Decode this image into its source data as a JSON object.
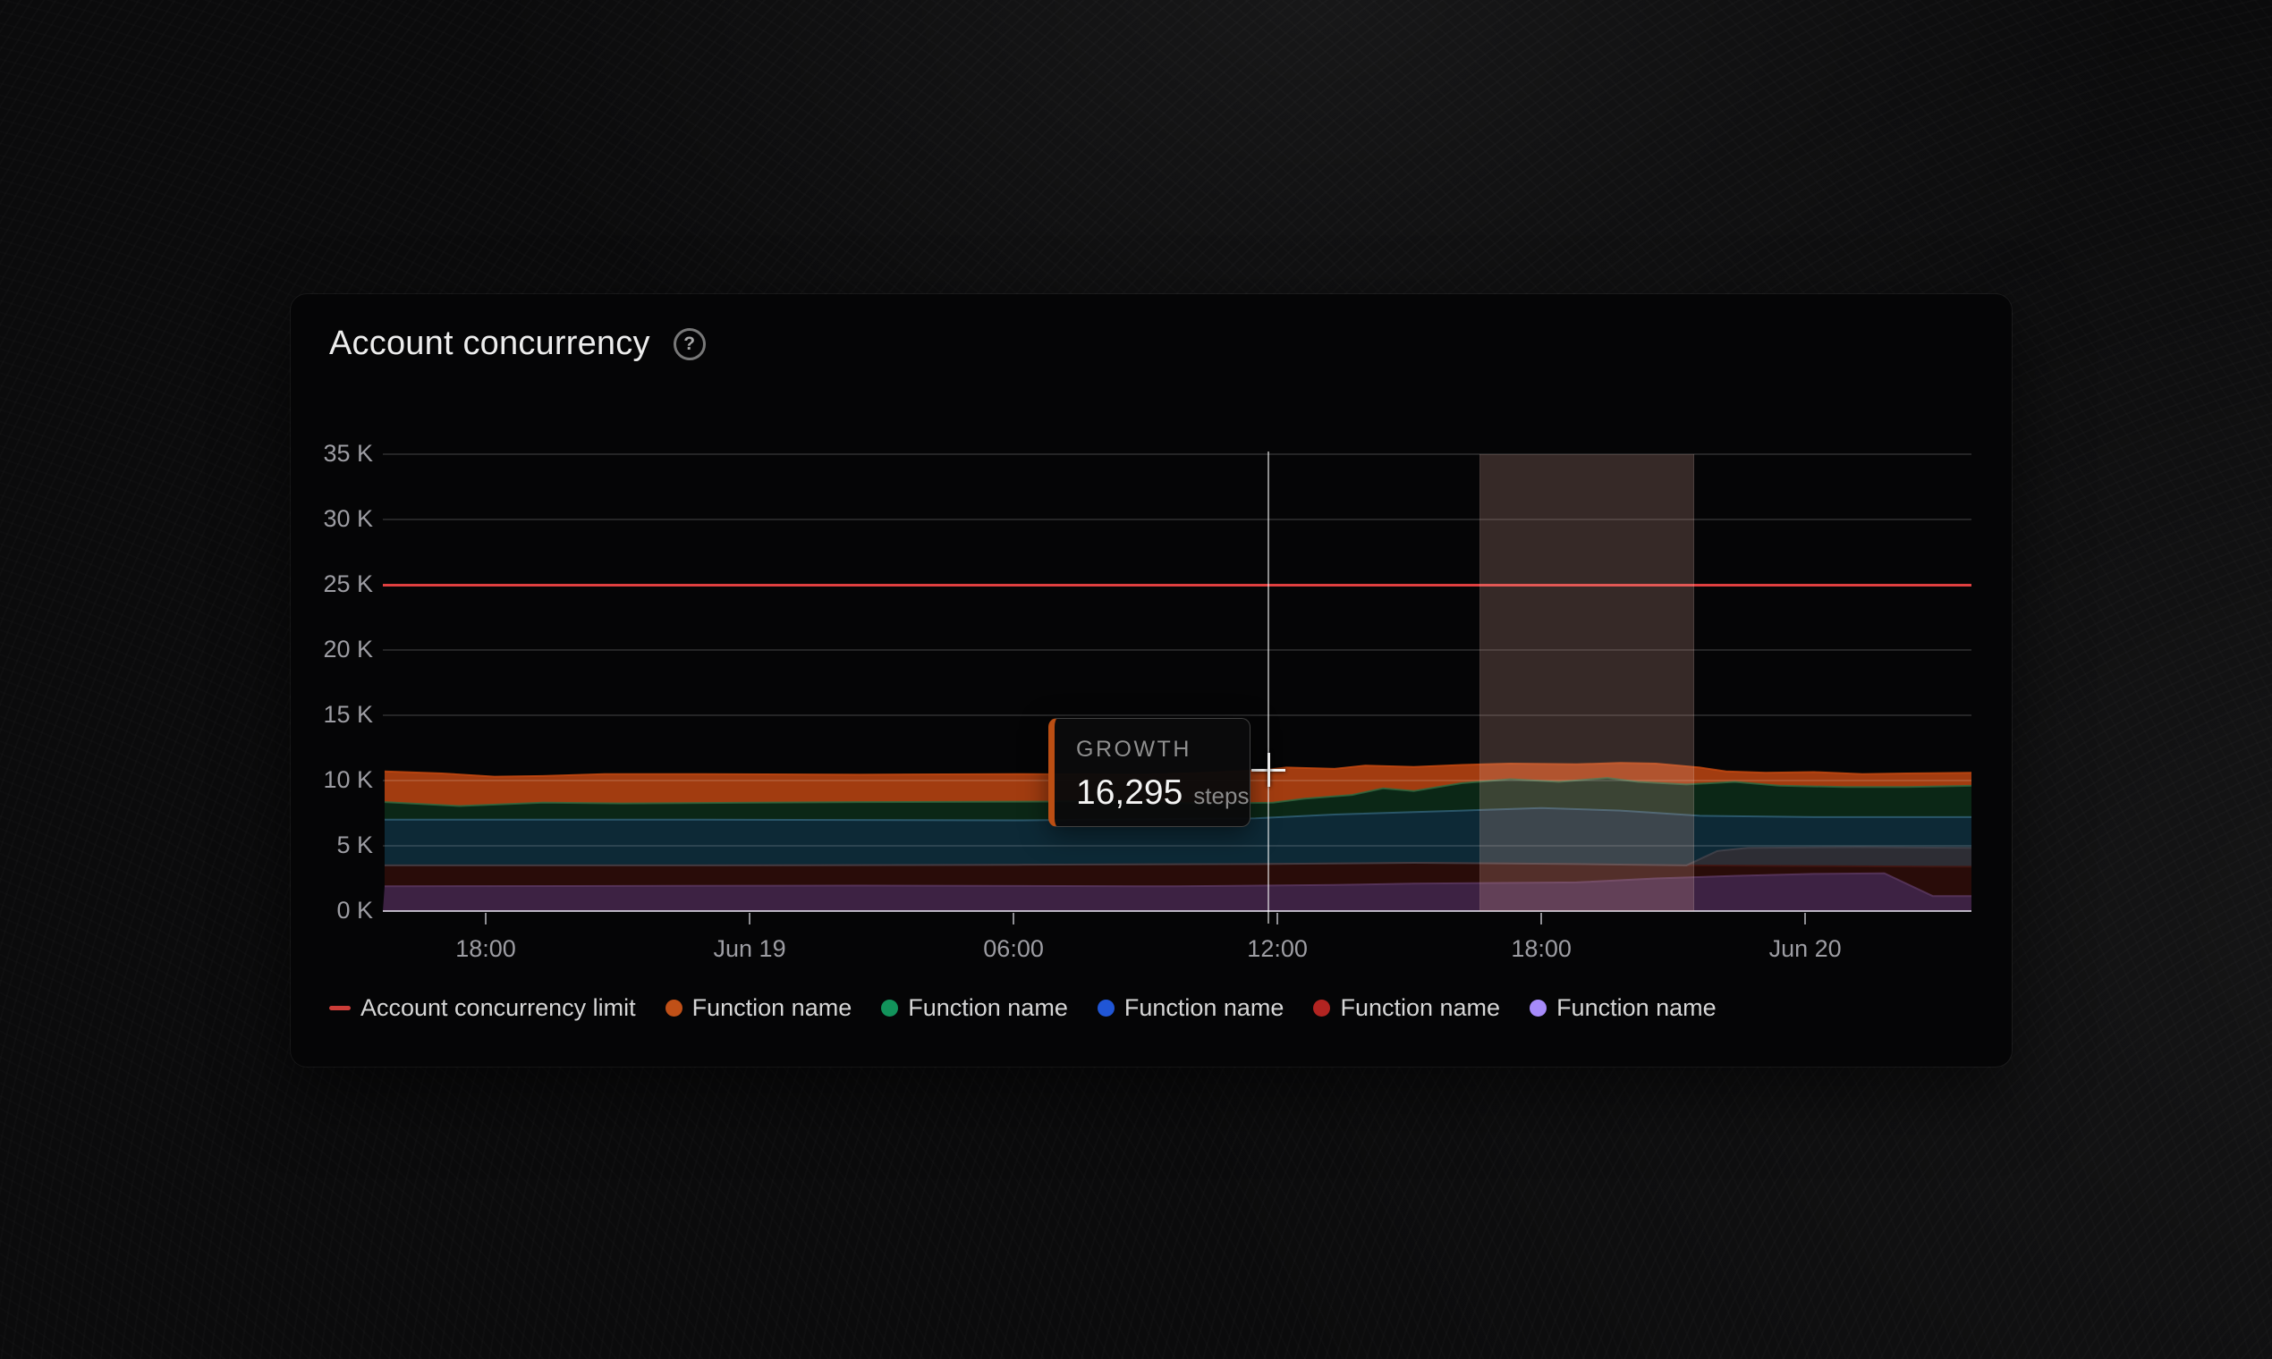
{
  "card": {
    "title": "Account concurrency",
    "help_icon_glyph": "?"
  },
  "chart_data": {
    "type": "area",
    "variant": "stacked",
    "title": "Account concurrency",
    "grid": "horizontal",
    "legend_position": "bottom",
    "y_axis": {
      "unit": "K",
      "ticks_k": [
        35,
        30,
        25,
        20,
        15,
        10,
        5,
        0
      ],
      "tick_labels": [
        "35 K",
        "30 K",
        "25 K",
        "20 K",
        "15 K",
        "10 K",
        "5 K",
        "0 K"
      ],
      "ylim_k": [
        0,
        35
      ]
    },
    "x_axis": {
      "domain_h": [
        -2.34,
        33.78
      ],
      "hours_per_major_tick": 6,
      "ticks": [
        {
          "h": 0,
          "label": "18:00"
        },
        {
          "h": 6,
          "label": "Jun 19"
        },
        {
          "h": 12,
          "label": "06:00"
        },
        {
          "h": 18,
          "label": "12:00"
        },
        {
          "h": 24,
          "label": "18:00"
        },
        {
          "h": 30,
          "label": "Jun 20"
        }
      ]
    },
    "limit_line": {
      "label": "Account concurrency limit",
      "value_k": 25,
      "color": "#e04040"
    },
    "highlight_window": {
      "from_h": 22.6,
      "to_h": 27.45
    },
    "crosshair": {
      "h": 17.8,
      "value_k": 10.8
    },
    "tooltip": {
      "series": "GROWTH",
      "value": "16,295",
      "unit": "steps"
    },
    "bands_note": "stacked band top boundaries; x = hours from first tick (18:00), y = thousands (K)",
    "bands": [
      {
        "name": "function-purple",
        "label": "Function name",
        "color": "#3d2243",
        "stroke": "#5c3a63",
        "points": [
          [
            -2.3,
            1.9
          ],
          [
            8.5,
            1.95
          ],
          [
            15.7,
            1.9
          ],
          [
            19.3,
            2.0
          ],
          [
            21.1,
            2.1
          ],
          [
            24.8,
            2.2
          ],
          [
            26.6,
            2.5
          ],
          [
            28.4,
            2.7
          ],
          [
            30.2,
            2.85
          ],
          [
            31.8,
            2.9
          ],
          [
            32.9,
            1.15
          ],
          [
            33.8,
            1.15
          ]
        ]
      },
      {
        "name": "function-red",
        "label": "Function name",
        "color": "#290c09",
        "stroke": "#451410",
        "points": [
          [
            -2.3,
            3.5
          ],
          [
            4.9,
            3.5
          ],
          [
            12.1,
            3.55
          ],
          [
            17.5,
            3.6
          ],
          [
            21.1,
            3.7
          ],
          [
            24.8,
            3.6
          ],
          [
            27.3,
            3.5
          ],
          [
            30.2,
            3.45
          ],
          [
            33.8,
            3.4
          ]
        ]
      },
      {
        "name": "band-slate",
        "label": "",
        "color": "#2d2d34",
        "stroke": "#45454e",
        "points": [
          [
            -2.3,
            3.5
          ],
          [
            4.9,
            3.5
          ],
          [
            12.1,
            3.55
          ],
          [
            17.5,
            3.6
          ],
          [
            21.1,
            3.7
          ],
          [
            24.8,
            3.6
          ],
          [
            27.3,
            3.5
          ],
          [
            28.0,
            4.6
          ],
          [
            28.7,
            4.85
          ],
          [
            31.2,
            4.9
          ],
          [
            33.8,
            4.85
          ]
        ]
      },
      {
        "name": "function-blue",
        "label": "Function name",
        "color": "#0d2936",
        "stroke": "#32637a",
        "points": [
          [
            -2.3,
            7.0
          ],
          [
            4.9,
            7.0
          ],
          [
            12.1,
            6.95
          ],
          [
            17.5,
            7.1
          ],
          [
            19.3,
            7.4
          ],
          [
            22.2,
            7.7
          ],
          [
            24.0,
            7.9
          ],
          [
            25.8,
            7.7
          ],
          [
            27.6,
            7.3
          ],
          [
            30.2,
            7.2
          ],
          [
            33.8,
            7.2
          ]
        ]
      },
      {
        "name": "function-green",
        "label": "Function name",
        "color": "#0b2716",
        "stroke": "#2d6b42",
        "points": [
          [
            -2.3,
            8.35
          ],
          [
            -0.6,
            8.05
          ],
          [
            1.3,
            8.3
          ],
          [
            3.1,
            8.25
          ],
          [
            8.5,
            8.35
          ],
          [
            13.9,
            8.4
          ],
          [
            16.4,
            8.25
          ],
          [
            17.9,
            8.3
          ],
          [
            18.6,
            8.6
          ],
          [
            19.7,
            8.9
          ],
          [
            20.4,
            9.4
          ],
          [
            21.1,
            9.2
          ],
          [
            22.2,
            9.8
          ],
          [
            23.3,
            10.1
          ],
          [
            24.4,
            9.9
          ],
          [
            25.5,
            10.2
          ],
          [
            26.2,
            9.9
          ],
          [
            27.3,
            9.7
          ],
          [
            28.4,
            9.9
          ],
          [
            29.4,
            9.6
          ],
          [
            30.9,
            9.5
          ],
          [
            32.3,
            9.5
          ],
          [
            33.8,
            9.6
          ]
        ]
      },
      {
        "name": "function-orange",
        "label": "Function name",
        "color": "#a23c10",
        "stroke": "#c84a10",
        "points": [
          [
            -2.3,
            10.7
          ],
          [
            -1.0,
            10.55
          ],
          [
            0.2,
            10.3
          ],
          [
            1.3,
            10.35
          ],
          [
            2.7,
            10.5
          ],
          [
            4.9,
            10.5
          ],
          [
            8.5,
            10.45
          ],
          [
            12.1,
            10.5
          ],
          [
            15.0,
            10.45
          ],
          [
            16.4,
            10.6
          ],
          [
            17.7,
            10.8
          ],
          [
            18.2,
            11.0
          ],
          [
            19.3,
            10.9
          ],
          [
            20.0,
            11.15
          ],
          [
            21.1,
            11.05
          ],
          [
            22.2,
            11.2
          ],
          [
            23.3,
            11.3
          ],
          [
            24.8,
            11.25
          ],
          [
            25.8,
            11.35
          ],
          [
            26.6,
            11.3
          ],
          [
            27.6,
            11.0
          ],
          [
            28.2,
            10.7
          ],
          [
            29.1,
            10.6
          ],
          [
            30.2,
            10.65
          ],
          [
            31.3,
            10.5
          ],
          [
            32.3,
            10.55
          ],
          [
            33.8,
            10.6
          ]
        ]
      }
    ],
    "legend": [
      {
        "label": "Account concurrency limit",
        "marker": "dash",
        "color": "#cc3d38"
      },
      {
        "label": "Function name",
        "marker": "dot",
        "color": "#c05017"
      },
      {
        "label": "Function name",
        "marker": "dot",
        "color": "#12935b"
      },
      {
        "label": "Function name",
        "marker": "dot",
        "color": "#2056d6"
      },
      {
        "label": "Function name",
        "marker": "dot",
        "color": "#b22421"
      },
      {
        "label": "Function name",
        "marker": "dot",
        "color": "#a78bfa"
      }
    ]
  }
}
